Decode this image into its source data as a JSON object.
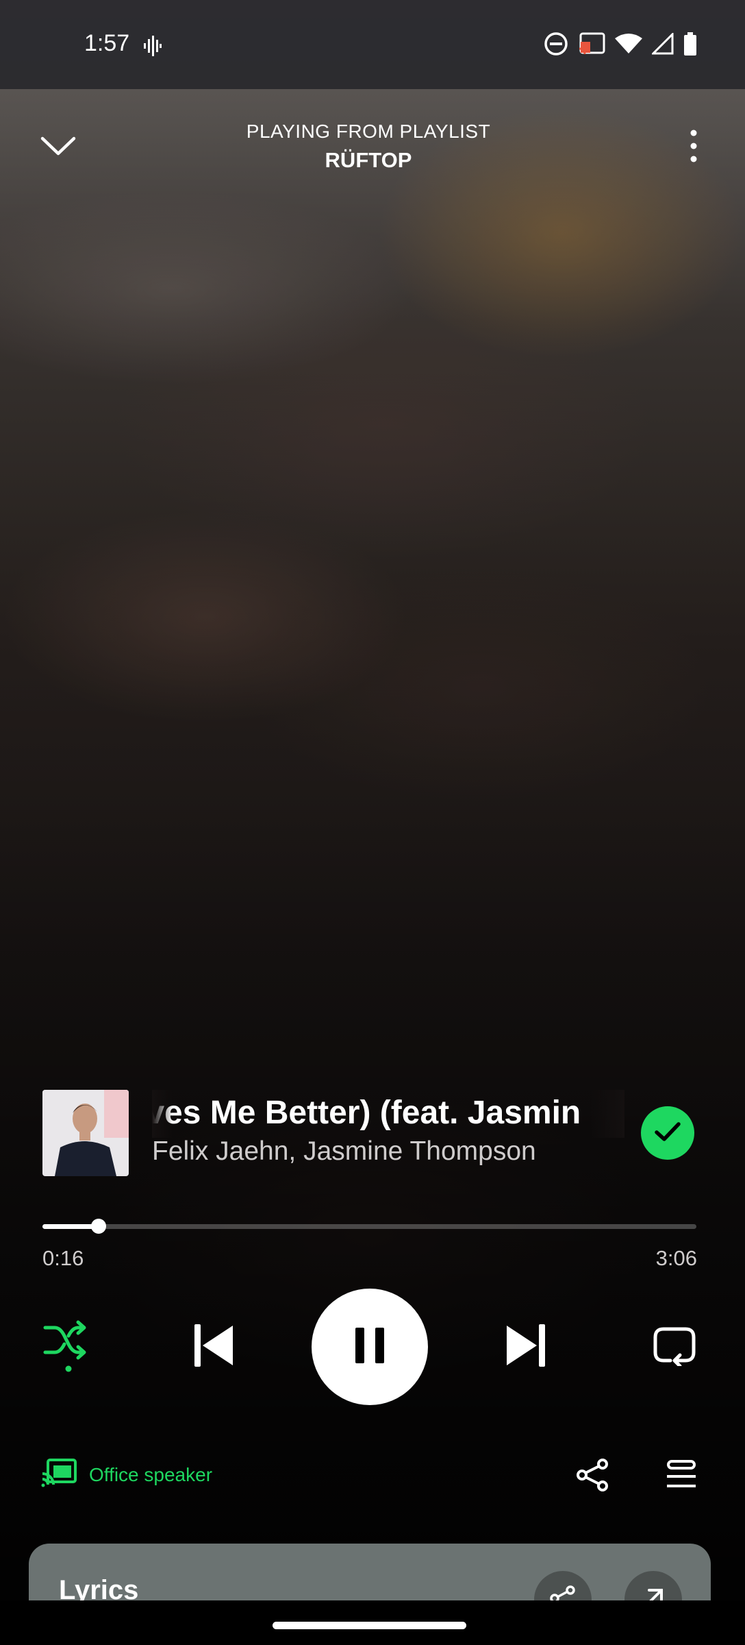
{
  "status_bar": {
    "time": "1:57"
  },
  "header": {
    "context_label": "PLAYING FROM PLAYLIST",
    "context_name": "RÜFTOP"
  },
  "track": {
    "title": "oves Me Better) (feat. Jasmin",
    "artist": "Felix Jaehn, Jasmine Thompson",
    "liked": true
  },
  "playback": {
    "elapsed": "0:16",
    "duration": "3:06",
    "progress": 0.086,
    "shuffle_on": true,
    "is_playing": true
  },
  "device": {
    "name": "Office speaker"
  },
  "lyrics": {
    "title": "Lyrics"
  },
  "colors": {
    "accent": "#1ed760",
    "status_bar": "#28282c",
    "lyrics_card": "#6b7372"
  },
  "icons": {
    "status": [
      "sound-wave-icon",
      "do-not-disturb-icon",
      "cast-icon",
      "wifi-icon",
      "signal-icon",
      "battery-icon"
    ],
    "header": [
      "chevron-down-icon",
      "more-vertical-icon"
    ],
    "controls": [
      "shuffle-icon",
      "skip-previous-icon",
      "pause-icon",
      "skip-next-icon",
      "repeat-icon"
    ],
    "bottom": [
      "cast-device-icon",
      "share-icon",
      "queue-icon"
    ]
  }
}
